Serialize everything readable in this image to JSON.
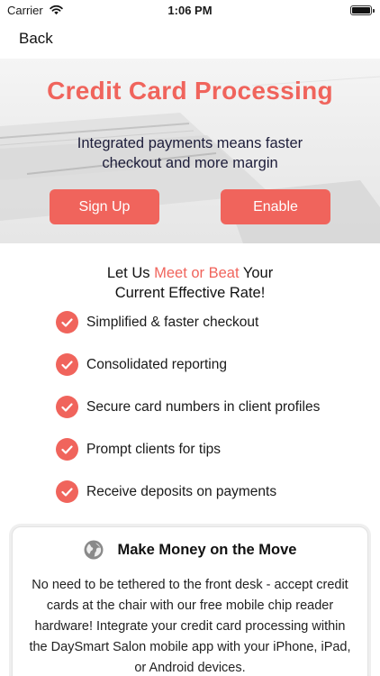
{
  "status_bar": {
    "carrier": "Carrier",
    "time": "1:06 PM"
  },
  "nav": {
    "back_label": "Back"
  },
  "hero": {
    "title": "Credit Card Processing",
    "subtitle": "Integrated payments means faster checkout and more margin",
    "signup_label": "Sign Up",
    "enable_label": "Enable"
  },
  "rate_heading": {
    "prefix": "Let Us ",
    "highlight": "Meet or Beat",
    "suffix": " Your",
    "line2": "Current Effective Rate!"
  },
  "features": [
    "Simplified & faster checkout",
    "Consolidated reporting",
    "Secure card numbers in client profiles",
    "Prompt clients for tips",
    "Receive deposits on payments"
  ],
  "card": {
    "title": "Make Money on the Move",
    "body": "No need to be tethered to the front desk - accept credit cards at the chair with our free mobile chip reader hardware! Integrate your credit card processing within the DaySmart Salon mobile app with your iPhone, iPad, or Android devices."
  },
  "colors": {
    "accent": "#f0645c",
    "text": "#1a1a1a"
  },
  "icons": [
    "wifi-icon",
    "battery-icon",
    "check-icon",
    "globe-icon"
  ]
}
